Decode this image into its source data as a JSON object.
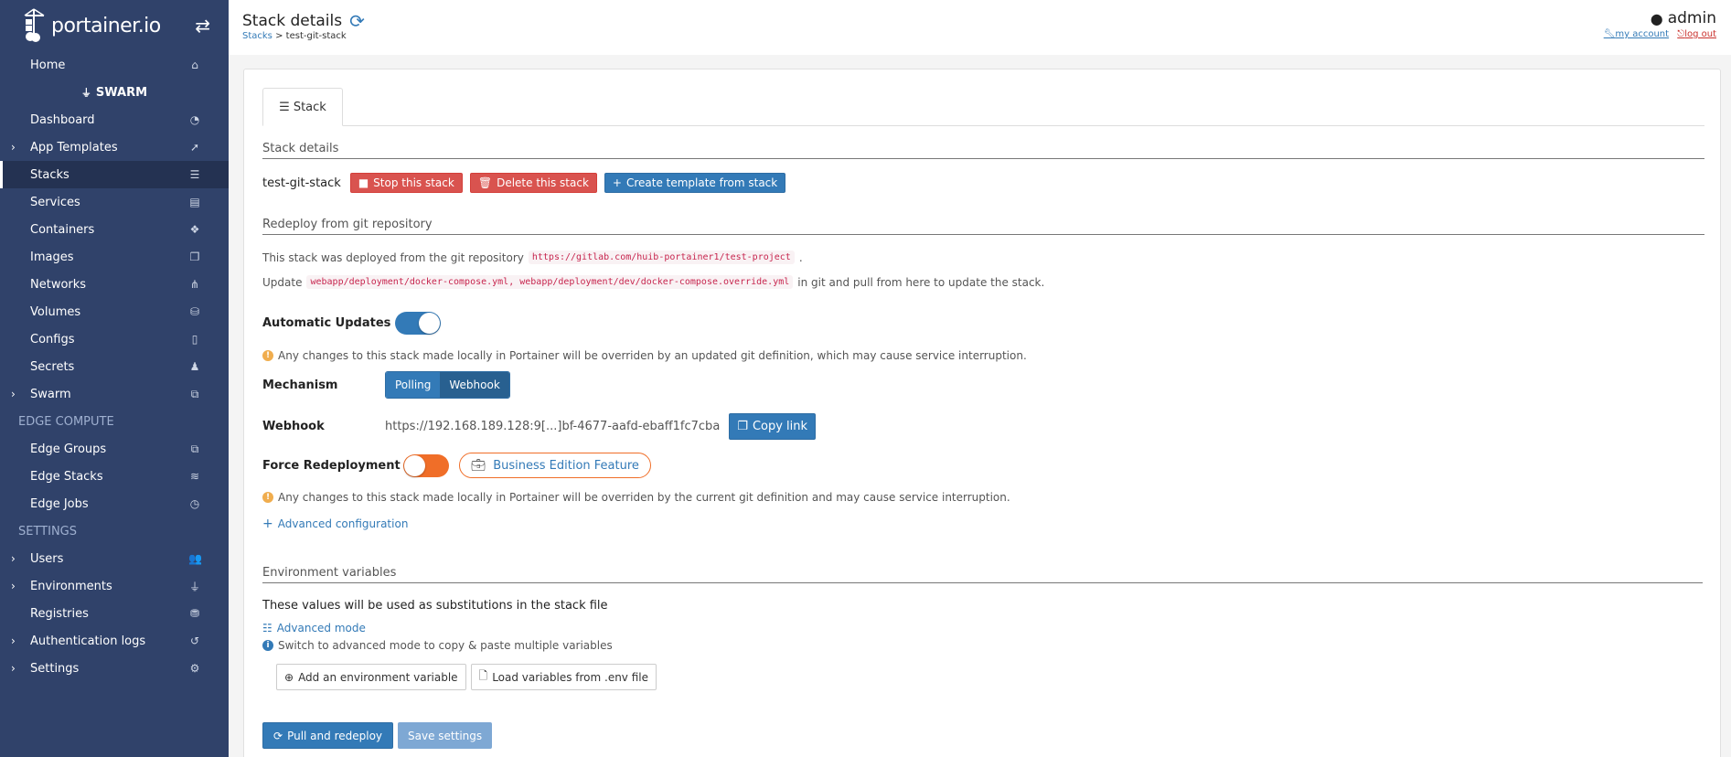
{
  "brand": {
    "name": "portainer.io"
  },
  "sidebar": {
    "home": "Home",
    "environment_name": "SWARM",
    "items": [
      {
        "label": "Dashboard",
        "icon": "dashboard-icon",
        "glyph": "◔"
      },
      {
        "label": "App Templates",
        "icon": "rocket-icon",
        "glyph": "➚",
        "expandable": true
      },
      {
        "label": "Stacks",
        "icon": "list-icon",
        "glyph": "☰",
        "active": true
      },
      {
        "label": "Services",
        "icon": "services-icon",
        "glyph": "▤"
      },
      {
        "label": "Containers",
        "icon": "cubes-icon",
        "glyph": "❖"
      },
      {
        "label": "Images",
        "icon": "images-icon",
        "glyph": "❐"
      },
      {
        "label": "Networks",
        "icon": "sitemap-icon",
        "glyph": "⋔"
      },
      {
        "label": "Volumes",
        "icon": "hdd-icon",
        "glyph": "⛁"
      },
      {
        "label": "Configs",
        "icon": "file-icon",
        "glyph": "▯"
      },
      {
        "label": "Secrets",
        "icon": "user-secret-icon",
        "glyph": "♟"
      },
      {
        "label": "Swarm",
        "icon": "object-group-icon",
        "glyph": "⧉",
        "expandable": true
      }
    ],
    "edge_heading": "EDGE COMPUTE",
    "edge_items": [
      {
        "label": "Edge Groups",
        "icon": "object-group-icon",
        "glyph": "⧉"
      },
      {
        "label": "Edge Stacks",
        "icon": "layer-group-icon",
        "glyph": "≋"
      },
      {
        "label": "Edge Jobs",
        "icon": "clock-icon",
        "glyph": "◷"
      }
    ],
    "settings_heading": "SETTINGS",
    "settings_items": [
      {
        "label": "Users",
        "icon": "users-icon",
        "glyph": "👥",
        "expandable": true
      },
      {
        "label": "Environments",
        "icon": "plug-icon",
        "glyph": "⏚",
        "expandable": true
      },
      {
        "label": "Registries",
        "icon": "database-icon",
        "glyph": "⛃"
      },
      {
        "label": "Authentication logs",
        "icon": "history-icon",
        "glyph": "↺",
        "expandable": true
      },
      {
        "label": "Settings",
        "icon": "cogs-icon",
        "glyph": "⚙",
        "expandable": true
      }
    ]
  },
  "header": {
    "title": "Stack details",
    "breadcrumb_parent": "Stacks",
    "breadcrumb_sep": " > ",
    "breadcrumb_current": "test-git-stack",
    "user": "admin",
    "my_account": "my account",
    "log_out": "log out"
  },
  "tab": {
    "label": "Stack"
  },
  "stack_details": {
    "section_title": "Stack details",
    "name": "test-git-stack",
    "stop_label": "Stop this stack",
    "delete_label": "Delete this stack",
    "template_label": "Create template from stack"
  },
  "git": {
    "section_title": "Redeploy from git repository",
    "deployed_prefix": "This stack was deployed from the git repository",
    "repo_url": "https://gitlab.com/huib-portainer1/test-project",
    "deployed_suffix": ".",
    "update_prefix": "Update",
    "files": "webapp/deployment/docker-compose.yml, webapp/deployment/dev/docker-compose.override.yml",
    "update_suffix": "in git and pull from here to update the stack.",
    "auto_updates_label": "Automatic Updates",
    "auto_updates_warning": "Any changes to this stack made locally in Portainer will be overriden by an updated git definition, which may cause service interruption.",
    "mechanism_label": "Mechanism",
    "mechanism_options": [
      "Polling",
      "Webhook"
    ],
    "webhook_label": "Webhook",
    "webhook_url": "https://192.168.189.128:9[...]bf-4677-aafd-ebaff1fc7cba",
    "copy_link": "Copy link",
    "force_label": "Force Redeployment",
    "be_feature": "Business Edition Feature",
    "force_warning": "Any changes to this stack made locally in Portainer will be overriden by the current git definition and may cause service interruption.",
    "advanced_config": "Advanced configuration"
  },
  "env": {
    "section_title": "Environment variables",
    "subtitle": "These values will be used as substitutions in the stack file",
    "advanced_mode": "Advanced mode",
    "advanced_hint": "Switch to advanced mode to copy & paste multiple variables",
    "add_var": "Add an environment variable",
    "load_vars": "Load variables from .env file"
  },
  "actions": {
    "pull_redeploy": "Pull and redeploy",
    "save_settings": "Save settings"
  },
  "colors": {
    "sidebar": "#30426a",
    "primary": "#337ab7",
    "danger": "#d9534f",
    "orange": "#f06e28"
  }
}
